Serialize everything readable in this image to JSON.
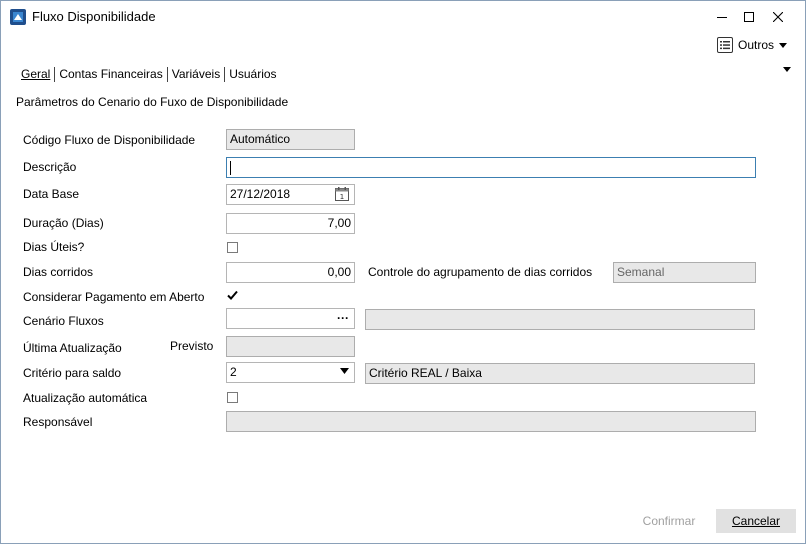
{
  "window": {
    "title": "Fluxo Disponibilidade"
  },
  "toolbar": {
    "outros_label": "Outros"
  },
  "tabs": [
    {
      "label": "Geral"
    },
    {
      "label": "Contas Financeiras"
    },
    {
      "label": "Variáveis"
    },
    {
      "label": "Usuários"
    }
  ],
  "section_title": "Parâmetros do Cenario do Fuxo de Disponibilidade",
  "form": {
    "codigo": {
      "label": "Código Fluxo de Disponibilidade",
      "value": "Automático"
    },
    "descricao": {
      "label": "Descrição",
      "value": ""
    },
    "data_base": {
      "label": "Data Base",
      "value": "27/12/2018"
    },
    "duracao": {
      "label": "Duração (Dias)",
      "value": "7,00"
    },
    "dias_uteis": {
      "label": "Dias Úteis?",
      "checked": false
    },
    "dias_corridos": {
      "label": "Dias corridos",
      "value": "0,00"
    },
    "controle_agrupamento": {
      "label": "Controle do agrupamento de dias corridos",
      "value": "Semanal"
    },
    "considerar_pagamento": {
      "label": "Considerar Pagamento em Aberto",
      "checked": true
    },
    "cenario_fluxos": {
      "label": "Cenário Fluxos",
      "value": "",
      "description": ""
    },
    "ultima_atualizacao": {
      "label": "Última Atualização",
      "sublabel": "Previsto",
      "value": ""
    },
    "criterio_saldo": {
      "label": "Critério para saldo",
      "value": "2",
      "description": "Critério REAL / Baixa"
    },
    "atualizacao_automatica": {
      "label": "Atualização automática",
      "checked": false
    },
    "responsavel": {
      "label": "Responsável",
      "value": ""
    }
  },
  "buttons": {
    "confirmar": "Confirmar",
    "cancelar": "Cancelar"
  },
  "colors": {
    "accent": "#3c7fb1",
    "readonly_bg": "#e8e8e8",
    "button_bg": "#e1e1e1"
  }
}
